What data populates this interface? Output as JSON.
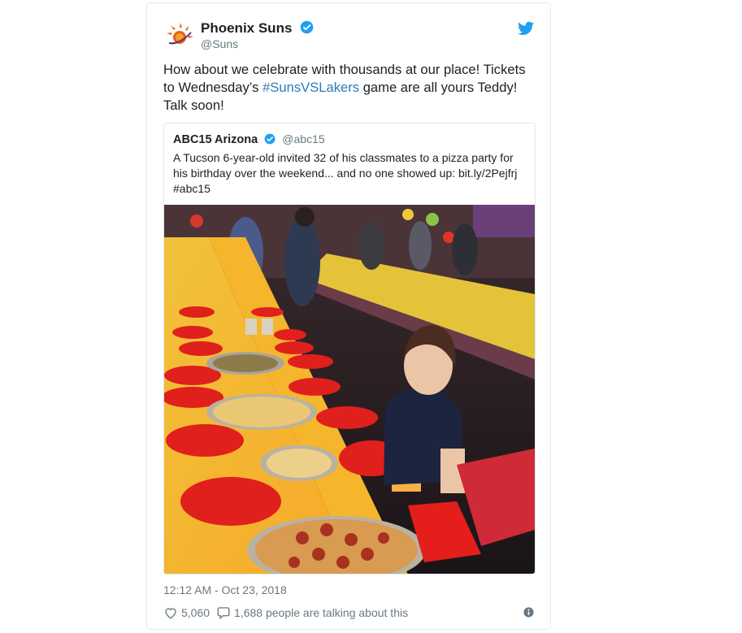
{
  "tweet": {
    "author_name": "Phoenix Suns",
    "author_handle": "@Suns",
    "text_before": "How about we celebrate with thousands at our place! Tickets to Wednesday’s ",
    "hashtag": "#SunsVSLakers",
    "text_after": " game are all yours Teddy! Talk soon!",
    "timestamp": "12:12 AM - Oct 23, 2018",
    "likes": "5,060",
    "talking": "1,688 people are talking about this"
  },
  "quoted": {
    "author_name": "ABC15 Arizona",
    "author_handle": "@abc15",
    "text": "A Tucson 6-year-old invited 32 of his classmates to a pizza party for his birthday over the weekend... and no one showed up: bit.ly/2Pejfrj #abc15"
  },
  "colors": {
    "link": "#2b7bb9",
    "verified": "#1da1f2",
    "muted": "#697882",
    "border": "#e1e8ed",
    "suns_orange": "#e56020"
  },
  "icons": [
    "suns-logo-icon",
    "verified-badge-icon",
    "twitter-bird-icon",
    "heart-icon",
    "reply-bubble-icon",
    "info-icon"
  ]
}
